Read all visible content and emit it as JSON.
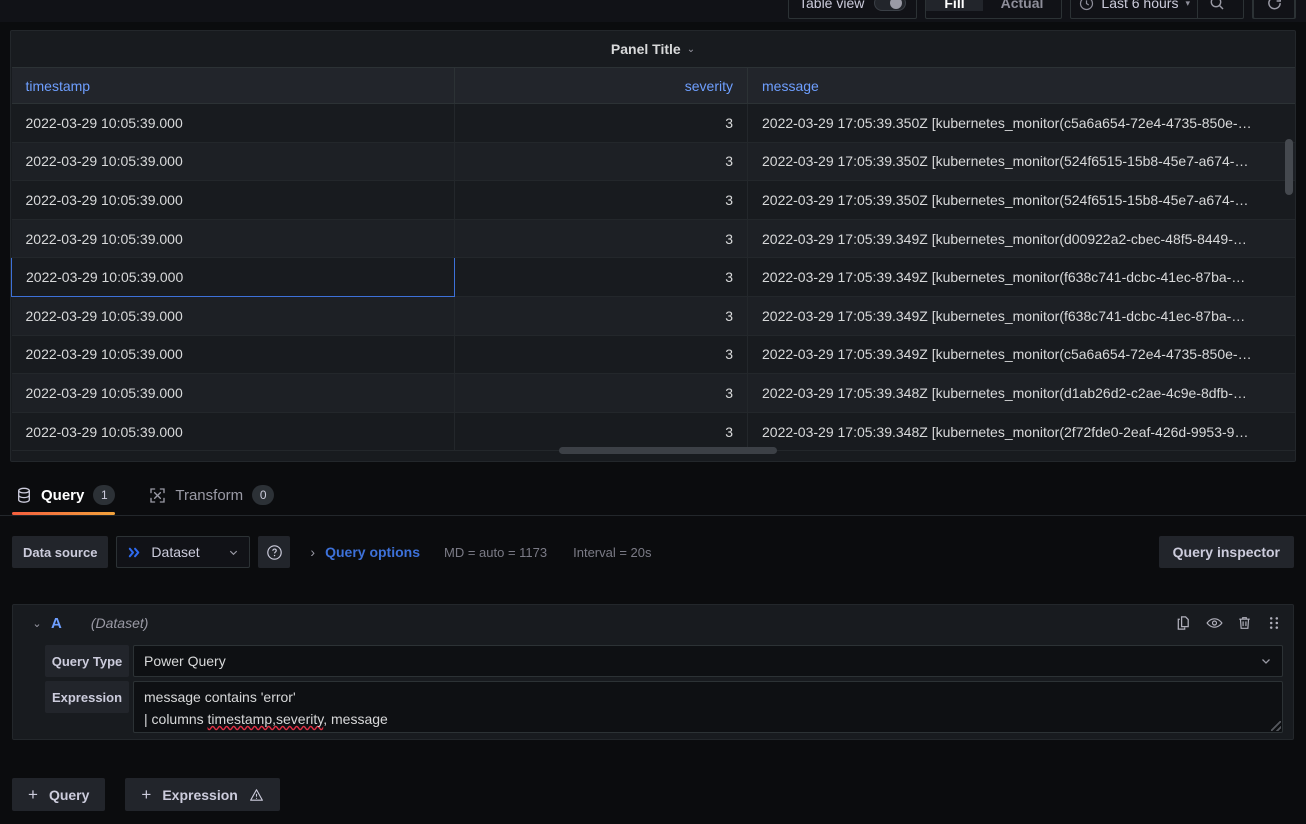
{
  "toolbar": {
    "table_view_label": "Table view",
    "table_view_on": false,
    "fill_label": "Fill",
    "actual_label": "Actual",
    "time_range_label": "Last 6 hours",
    "zoom_icon": "search-icon",
    "refresh_icon": "refresh-icon"
  },
  "panel": {
    "title": "Panel Title",
    "menu_caret": "chevron-down-icon"
  },
  "table": {
    "columns": [
      "timestamp",
      "severity",
      "message"
    ],
    "rows": [
      {
        "timestamp": "2022-03-29 10:05:39.000",
        "severity": "3",
        "message": "2022-03-29 17:05:39.350Z [kubernetes_monitor(c5a6a654-72e4-4735-850e-…"
      },
      {
        "timestamp": "2022-03-29 10:05:39.000",
        "severity": "3",
        "message": "2022-03-29 17:05:39.350Z [kubernetes_monitor(524f6515-15b8-45e7-a674-…"
      },
      {
        "timestamp": "2022-03-29 10:05:39.000",
        "severity": "3",
        "message": "2022-03-29 17:05:39.350Z [kubernetes_monitor(524f6515-15b8-45e7-a674-…"
      },
      {
        "timestamp": "2022-03-29 10:05:39.000",
        "severity": "3",
        "message": "2022-03-29 17:05:39.349Z [kubernetes_monitor(d00922a2-cbec-48f5-8449-…"
      },
      {
        "timestamp": "2022-03-29 10:05:39.000",
        "severity": "3",
        "message": "2022-03-29 17:05:39.349Z [kubernetes_monitor(f638c741-dcbc-41ec-87ba-…"
      },
      {
        "timestamp": "2022-03-29 10:05:39.000",
        "severity": "3",
        "message": "2022-03-29 17:05:39.349Z [kubernetes_monitor(f638c741-dcbc-41ec-87ba-…"
      },
      {
        "timestamp": "2022-03-29 10:05:39.000",
        "severity": "3",
        "message": "2022-03-29 17:05:39.349Z [kubernetes_monitor(c5a6a654-72e4-4735-850e-…"
      },
      {
        "timestamp": "2022-03-29 10:05:39.000",
        "severity": "3",
        "message": "2022-03-29 17:05:39.348Z [kubernetes_monitor(d1ab26d2-c2ae-4c9e-8dfb-…"
      },
      {
        "timestamp": "2022-03-29 10:05:39.000",
        "severity": "3",
        "message": "2022-03-29 17:05:39.348Z [kubernetes_monitor(2f72fde0-2eaf-426d-9953-9…"
      }
    ],
    "selected_row_index": 4
  },
  "tabs": [
    {
      "label": "Query",
      "badge": "1",
      "icon": "database-icon",
      "active": true
    },
    {
      "label": "Transform",
      "badge": "0",
      "icon": "transform-icon",
      "active": false
    }
  ],
  "query_bar": {
    "data_source_label": "Data source",
    "data_source_name": "Dataset",
    "data_source_icon": "double-chevron-icon",
    "help_icon": "question-circle-icon",
    "query_options_label": "Query options",
    "max_data_points": "MD = auto = 1173",
    "interval": "Interval = 20s",
    "query_inspector_label": "Query inspector"
  },
  "query_row": {
    "ref_id": "A",
    "data_source": "(Dataset)",
    "actions": [
      "copy-icon",
      "eye-icon",
      "trash-icon",
      "drag-handle-icon"
    ],
    "query_type_label": "Query Type",
    "query_type_value": "Power Query",
    "expression_label": "Expression",
    "expression_line1": "message contains 'error'",
    "expression_line2_prefix": "| columns ",
    "expression_line2_misspelled": "timestamp,severity",
    "expression_line2_suffix": ", message"
  },
  "bottom": {
    "add_query_label": "Query",
    "add_expression_label": "Expression",
    "plus": "+",
    "warning_icon": "warning-triangle-icon"
  },
  "colors": {
    "accent_blue": "#3d71d9",
    "header_blue": "#6e9fff",
    "tab_underline_from": "#f55f3e",
    "tab_underline_to": "#f2a33c",
    "panel_bg": "#181b1f",
    "page_bg": "#0b0c0e"
  }
}
